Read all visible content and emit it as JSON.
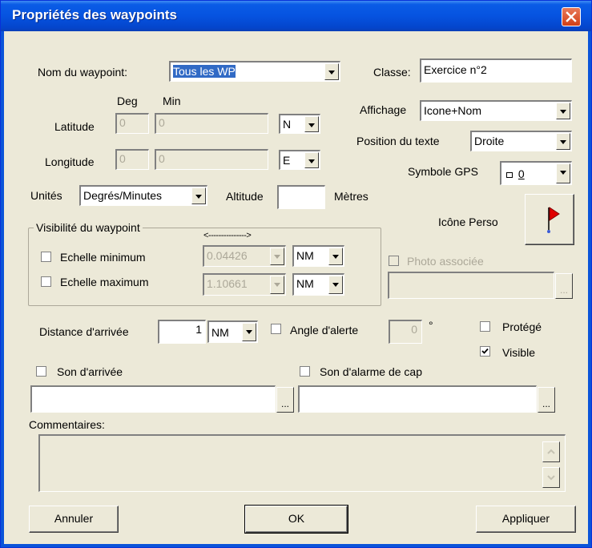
{
  "window": {
    "title": "Propriétés des waypoints"
  },
  "name": {
    "label": "Nom du waypoint:",
    "value": "Tous les WP"
  },
  "classe": {
    "label": "Classe:",
    "value": "Exercice n°2"
  },
  "coords": {
    "deg_header": "Deg",
    "min_header": "Min",
    "latitude_label": "Latitude",
    "lat_deg": "0",
    "lat_min": "0",
    "lat_hemi": "N",
    "longitude_label": "Longitude",
    "lon_deg": "0",
    "lon_min": "0",
    "lon_hemi": "E"
  },
  "affichage": {
    "label": "Affichage",
    "value": "Icone+Nom"
  },
  "position_texte": {
    "label": "Position du texte",
    "value": "Droite"
  },
  "symbole": {
    "label": "Symbole GPS",
    "value": "0"
  },
  "units": {
    "label": "Unités",
    "value": "Degrés/Minutes"
  },
  "altitude": {
    "label": "Altitude",
    "value": "",
    "unit": "Mètres"
  },
  "icone_perso": {
    "label": "Icône Perso"
  },
  "visibilite": {
    "group_label": "Visibilité du waypoint",
    "arrow": "<--------------->",
    "min_label": "Echelle minimum",
    "min_value": "0.04426",
    "min_unit": "NM",
    "max_label": "Echelle maximum",
    "max_value": "1.10661",
    "max_unit": "NM"
  },
  "photo": {
    "label": "Photo associée",
    "value": "",
    "browse": "..."
  },
  "distance": {
    "label": "Distance d'arrivée",
    "value": "1",
    "unit": "NM"
  },
  "angle": {
    "label": "Angle d'alerte",
    "value": "0",
    "unit": "°"
  },
  "protege": {
    "label": "Protégé",
    "checked": false
  },
  "visible": {
    "label": "Visible",
    "checked": true
  },
  "son_arrivee": {
    "label": "Son d'arrivée",
    "value": "",
    "browse": "..."
  },
  "son_alarme": {
    "label": "Son d'alarme de cap",
    "value": "",
    "browse": "..."
  },
  "commentaires": {
    "label": "Commentaires:",
    "value": ""
  },
  "buttons": {
    "cancel": "Annuler",
    "ok": "OK",
    "apply": "Appliquer"
  }
}
